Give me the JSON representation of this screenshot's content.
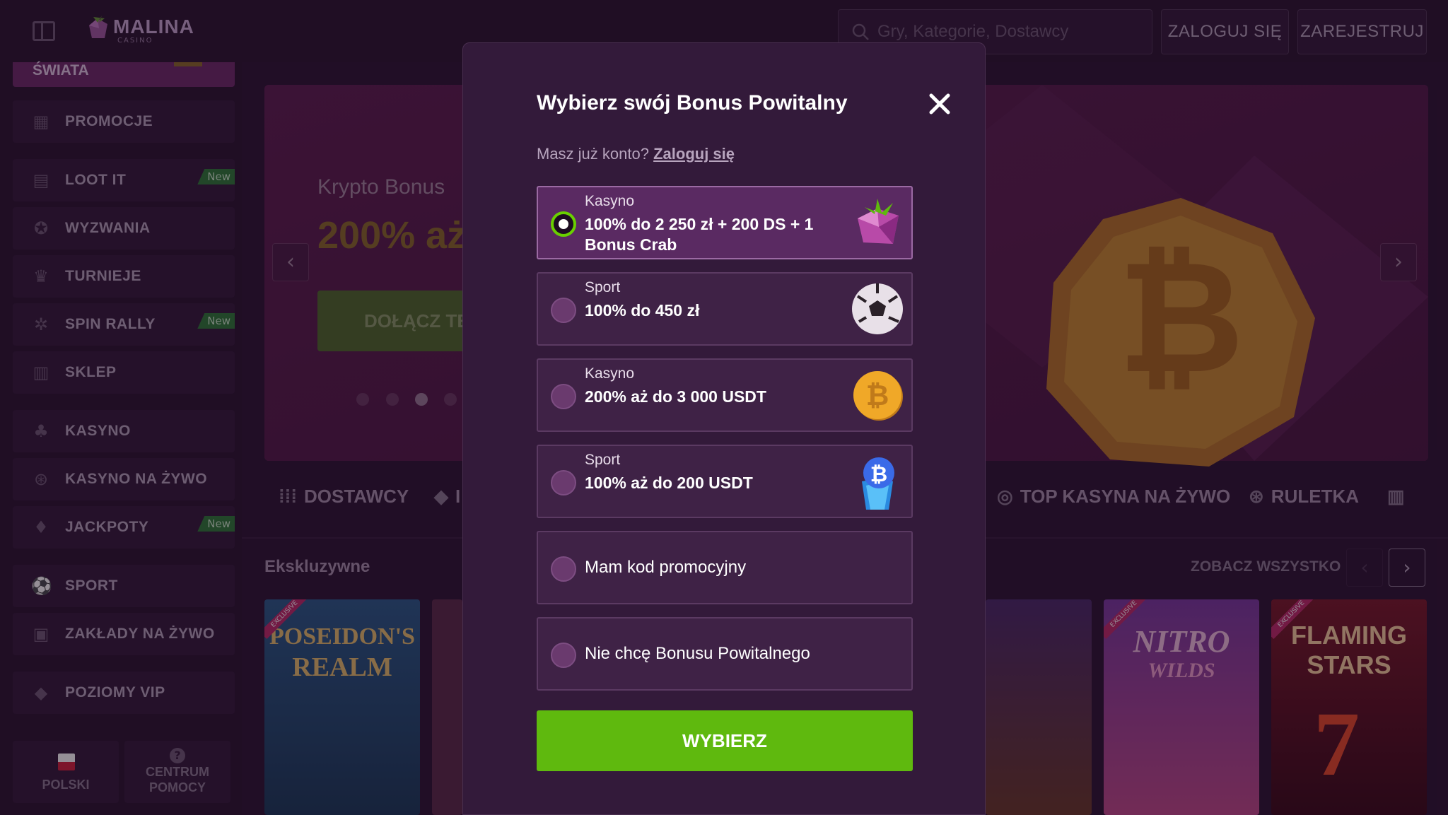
{
  "header": {
    "logo_text": "MALINA",
    "logo_sub": "CASINO",
    "search_placeholder": "Gry, Kategorie, Dostawcy",
    "login_label": "ZALOGUJ SIĘ",
    "register_label": "ZAREJESTRUJ"
  },
  "sidebar": {
    "top_item": "ŚWIATA",
    "items": [
      {
        "label": "PROMOCJE",
        "icon": "gift-icon",
        "badge": ""
      },
      {
        "label": "LOOT IT",
        "icon": "chest-icon",
        "badge": "New"
      },
      {
        "label": "WYZWANIA",
        "icon": "medal-icon",
        "badge": ""
      },
      {
        "label": "TURNIEJE",
        "icon": "trophy-icon",
        "badge": ""
      },
      {
        "label": "SPIN RALLY",
        "icon": "rally-icon",
        "badge": "New"
      },
      {
        "label": "SKLEP",
        "icon": "shop-icon",
        "badge": ""
      },
      {
        "label": "KASYNO",
        "icon": "cherries-icon",
        "badge": ""
      },
      {
        "label": "KASYNO NA ŻYWO",
        "icon": "roulette-icon",
        "badge": ""
      },
      {
        "label": "JACKPOTY",
        "icon": "jackpot-icon",
        "badge": "New"
      },
      {
        "label": "SPORT",
        "icon": "football-icon",
        "badge": ""
      },
      {
        "label": "ZAKŁADY NA ŻYWO",
        "icon": "live-bet-icon",
        "badge": ""
      },
      {
        "label": "POZIOMY VIP",
        "icon": "diamond-icon",
        "badge": ""
      }
    ],
    "language_label": "POLSKI",
    "help_label_1": "CENTRUM",
    "help_label_2": "POMOCY"
  },
  "hero": {
    "title": "Krypto Bonus",
    "big_text": "200% aż",
    "button_label": "DOŁĄCZ TE"
  },
  "categories": {
    "providers": "DOSTAWCY",
    "partial": "I",
    "top_live": "TOP KASYNA NA ŻYWO",
    "roulette": "RULETKA"
  },
  "section": {
    "title": "Ekskluzywne",
    "see_all": "ZOBACZ WSZYSTKO"
  },
  "games": [
    {
      "title_1": "POSEIDON'S",
      "title_2": "REALM",
      "badge": "EXCLUSIVE"
    },
    {
      "title_1": "NITRO",
      "title_2": "WILDS",
      "badge": "EXCLUSIVE"
    },
    {
      "title_1": "FLAMING",
      "title_2": "STARS",
      "badge": "EXCLUSIVE"
    }
  ],
  "modal": {
    "title": "Wybierz swój Bonus Powitalny",
    "subtitle": "Masz już konto?",
    "login_link": "Zaloguj się",
    "options": [
      {
        "category": "Kasyno",
        "value": "100% do 2 250 zł + 200 DS + 1 Bonus Crab",
        "selected": true,
        "image": "gem-icon"
      },
      {
        "category": "Sport",
        "value": "100% do 450 zł",
        "selected": false,
        "image": "football-icon"
      },
      {
        "category": "Kasyno",
        "value": "200% aż do 3 000 USDT",
        "selected": false,
        "image": "bitcoin-coin-icon"
      },
      {
        "category": "Sport",
        "value": "100% aż do 200 USDT",
        "selected": false,
        "image": "bitcoin-crystal-icon"
      }
    ],
    "promo_code_label": "Mam kod promocyjny",
    "no_bonus_label": "Nie chcę Bonusu Powitalnego",
    "select_button": "WYBIERZ"
  },
  "colors": {
    "accent_green": "#5fb90e",
    "modal_bg": "#331a3a",
    "selected_option": "#5a2a62"
  }
}
